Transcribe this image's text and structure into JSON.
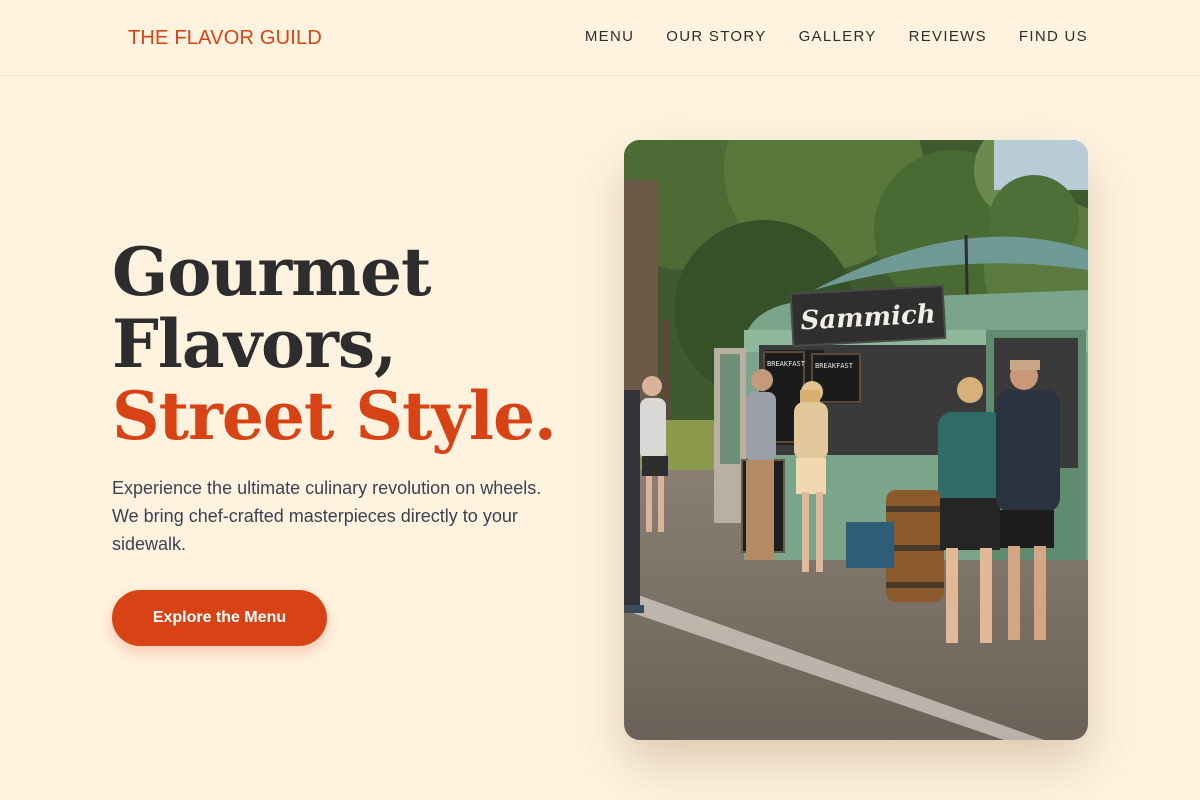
{
  "header": {
    "brand": "THE FLAVOR GUILD",
    "nav": [
      "MENU",
      "OUR STORY",
      "GALLERY",
      "REVIEWS",
      "FIND US"
    ]
  },
  "hero": {
    "title_line1": "Gourmet",
    "title_line2": "Flavors,",
    "title_line3": "Street Style.",
    "subtitle": "Experience the ultimate culinary revolution on wheels. We bring chef-crafted masterpieces directly to your sidewalk.",
    "cta_label": "Explore the Menu"
  },
  "photo": {
    "truck_sign": "Sammich",
    "board_left": "BREAKFAST SAMMICHES",
    "board_right": "BREAKFAST SPECIAL"
  },
  "colors": {
    "background": "#fff3e0",
    "accent": "#d84315",
    "text": "#2d2d2d",
    "truck": "#7aa58a"
  }
}
